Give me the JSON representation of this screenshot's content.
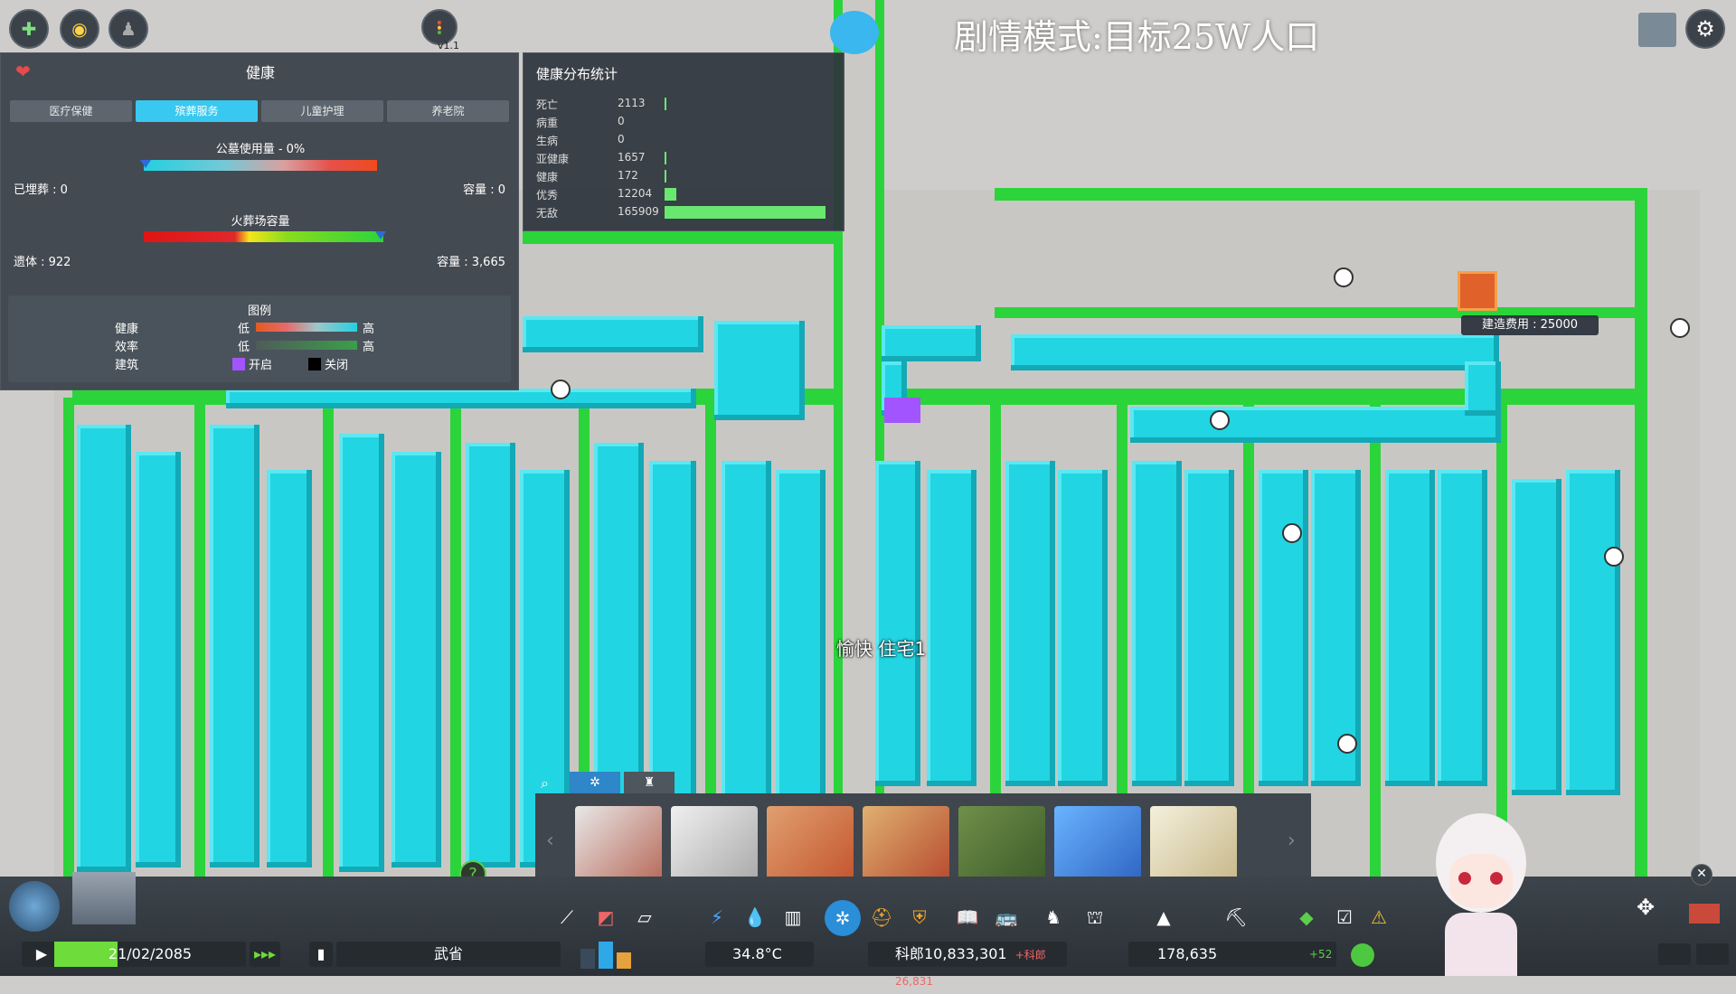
{
  "top": {
    "scenario_title": "剧情模式:目标25W人口",
    "traffic_version": "v1.1"
  },
  "health_panel": {
    "title": "健康",
    "tabs": [
      {
        "label": "医疗保健",
        "active": false
      },
      {
        "label": "殡葬服务",
        "active": true
      },
      {
        "label": "儿童护理",
        "active": false
      },
      {
        "label": "养老院",
        "active": false
      }
    ],
    "cemetery_usage_label": "公墓使用量 - 0%",
    "buried_label": "已埋葬 : 0",
    "cemetery_capacity_label": "容量 : 0",
    "crematorium_label": "火葬场容量",
    "deceased_label": "遗体 : 922",
    "crematorium_capacity_label": "容量 : 3,665",
    "legend": {
      "title": "图例",
      "rows": [
        {
          "name": "健康",
          "low": "低",
          "high": "高"
        },
        {
          "name": "效率",
          "low": "低",
          "high": "高"
        }
      ],
      "building_label": "建筑",
      "on_label": "开启",
      "off_label": "关闭",
      "on_color": "#a255ff",
      "off_color": "#000000"
    }
  },
  "stats_panel": {
    "title": "健康分布统计",
    "rows": [
      {
        "label": "死亡",
        "value": "2113",
        "num": 2113
      },
      {
        "label": "病重",
        "value": "0",
        "num": 0
      },
      {
        "label": "生病",
        "value": "0",
        "num": 0
      },
      {
        "label": "亚健康",
        "value": "1657",
        "num": 1657
      },
      {
        "label": "健康",
        "value": "172",
        "num": 172
      },
      {
        "label": "优秀",
        "value": "12204",
        "num": 12204
      },
      {
        "label": "无敌",
        "value": "165909",
        "num": 165909
      }
    ],
    "max": 165909
  },
  "map": {
    "hover_label": "愉快 住宅1",
    "build_cost": "建造费用 : 25000"
  },
  "status_bar": {
    "date": "21/02/2085",
    "city_name": "武省",
    "temperature": "34.8°C",
    "money": "科郎10,833,301",
    "income": "+科郎26,831",
    "population": "178,635",
    "pop_delta": "+52",
    "help": "?"
  },
  "icons": {
    "heart": "heart-icon",
    "settings": "gear-icon",
    "search": "search-icon"
  }
}
